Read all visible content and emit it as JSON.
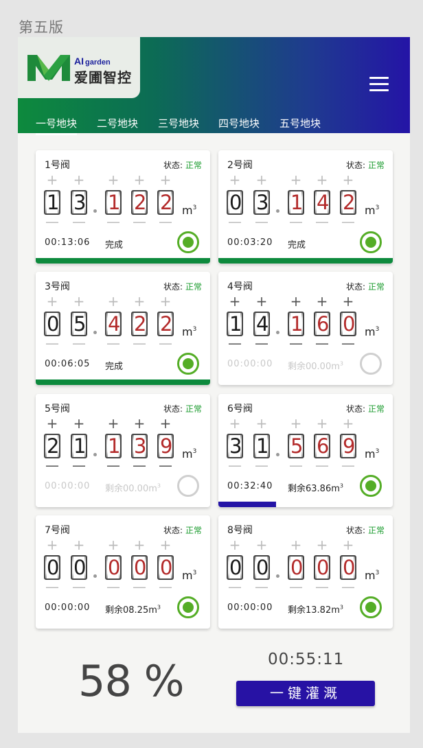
{
  "version_label": "第五版",
  "brand": {
    "ai": "AI",
    "garden": "garden",
    "name": "爱圃智控",
    "primary_green": "#0d8a3d",
    "primary_blue": "#2414a6"
  },
  "menu_icon": "hamburger-menu-icon",
  "tabs": [
    {
      "label": "一号地块",
      "active": true
    },
    {
      "label": "二号地块",
      "active": false
    },
    {
      "label": "三号地块",
      "active": false
    },
    {
      "label": "四号地块",
      "active": false
    },
    {
      "label": "五号地块",
      "active": false
    }
  ],
  "status_label": "状态:",
  "unit": "m",
  "unit_sup": "3",
  "plus_symbol": "+",
  "minus_symbol": "—",
  "valves": [
    {
      "title": "1号阀",
      "status": "正常",
      "digits": [
        "1",
        "3",
        "1",
        "2",
        "2"
      ],
      "time": "00:13:06",
      "info": "完成",
      "info_sup": "",
      "active": true,
      "muted": false,
      "progress": 1.0,
      "progress_color": "#0d8a3d"
    },
    {
      "title": "2号阀",
      "status": "正常",
      "digits": [
        "0",
        "3",
        "1",
        "4",
        "2"
      ],
      "time": "00:03:20",
      "info": "完成",
      "info_sup": "",
      "active": true,
      "muted": false,
      "progress": 1.0,
      "progress_color": "#0d8a3d"
    },
    {
      "title": "3号阀",
      "status": "正常",
      "digits": [
        "0",
        "5",
        "4",
        "2",
        "2"
      ],
      "time": "00:06:05",
      "info": "完成",
      "info_sup": "",
      "active": true,
      "muted": false,
      "progress": 1.0,
      "progress_color": "#0d8a3d"
    },
    {
      "title": "4号阀",
      "status": "正常",
      "digits": [
        "1",
        "4",
        "1",
        "6",
        "0"
      ],
      "time": "00:00:00",
      "info": "剩余00.00m",
      "info_sup": "3",
      "active": false,
      "muted": true,
      "progress": 0,
      "progress_color": "#0d8a3d",
      "dark_controls": true
    },
    {
      "title": "5号阀",
      "status": "正常",
      "digits": [
        "2",
        "1",
        "1",
        "3",
        "9"
      ],
      "time": "00:00:00",
      "info": "剩余00.00m",
      "info_sup": "3",
      "active": false,
      "muted": true,
      "progress": 0,
      "progress_color": "#0d8a3d",
      "dark_controls": true
    },
    {
      "title": "6号阀",
      "status": "正常",
      "digits": [
        "3",
        "1",
        "5",
        "6",
        "9"
      ],
      "time": "00:32:40",
      "info": "剩余63.86m",
      "info_sup": "3",
      "active": true,
      "muted": false,
      "progress": 0.33,
      "progress_color": "#2414a6"
    },
    {
      "title": "7号阀",
      "status": "正常",
      "digits": [
        "0",
        "0",
        "0",
        "0",
        "0"
      ],
      "time": "00:00:00",
      "info": "剩余08.25m",
      "info_sup": "3",
      "active": true,
      "muted": false,
      "progress": 0,
      "progress_color": "#0d8a3d"
    },
    {
      "title": "8号阀",
      "status": "正常",
      "digits": [
        "0",
        "0",
        "0",
        "0",
        "0"
      ],
      "time": "00:00:00",
      "info": "剩余13.82m",
      "info_sup": "3",
      "active": true,
      "muted": false,
      "progress": 0,
      "progress_color": "#0d8a3d"
    }
  ],
  "summary": {
    "percent": "58 %",
    "total_time": "00:55:11",
    "button_label": "一键灌溉"
  }
}
